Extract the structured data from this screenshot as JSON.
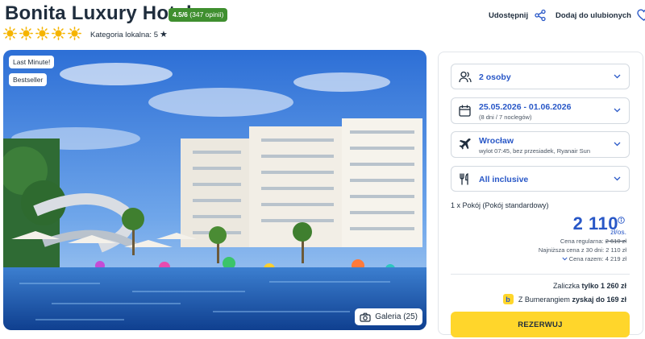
{
  "hotel": {
    "name": "Bonita Luxury Hotel",
    "rating": "4.5/6",
    "reviews": "(347 opinii)",
    "sun_count": 5,
    "category_label": "Kategoria lokalna: 5",
    "category_star": "★"
  },
  "actions": {
    "share_label": "Udostępnij",
    "favorite_label": "Dodaj do ulubionych"
  },
  "photo": {
    "tags": [
      "Last Minute!",
      "Bestseller"
    ],
    "gallery_label": "Galeria (25)"
  },
  "booking": {
    "guests": "2 osoby",
    "dates": "25.05.2026 - 01.06.2026",
    "dates_sub": "(8 dni / 7 noclegów)",
    "departure": "Wrocław",
    "departure_sub": "wylot 07:45, bez przesiadek, Ryanair Sun",
    "board": "All inclusive",
    "room": "1 x Pokój   (Pokój standardowy)",
    "price": "2 110",
    "price_unit": "zł/os.",
    "regular_label": "Cena regularna:",
    "regular_price": "2 610 zł",
    "lowest_label": "Najniższa cena z 30 dni:",
    "lowest_price": "2 110 zł",
    "total_label": "Cena razem:",
    "total_price": "4 219 zł",
    "deposit_label": "Zaliczka",
    "deposit_value": "tylko 1 260 zł",
    "bumerang_label": "Z Bumerangiem",
    "bumerang_value": "zyskaj do 169 zł",
    "reserve_label": "REZERWUJ"
  },
  "colors": {
    "accent": "#2857c7",
    "rating_badge": "#3f8f2f",
    "sun": "#f5b400",
    "reserve_button": "#ffd62b",
    "text": "#1f2d3d"
  }
}
